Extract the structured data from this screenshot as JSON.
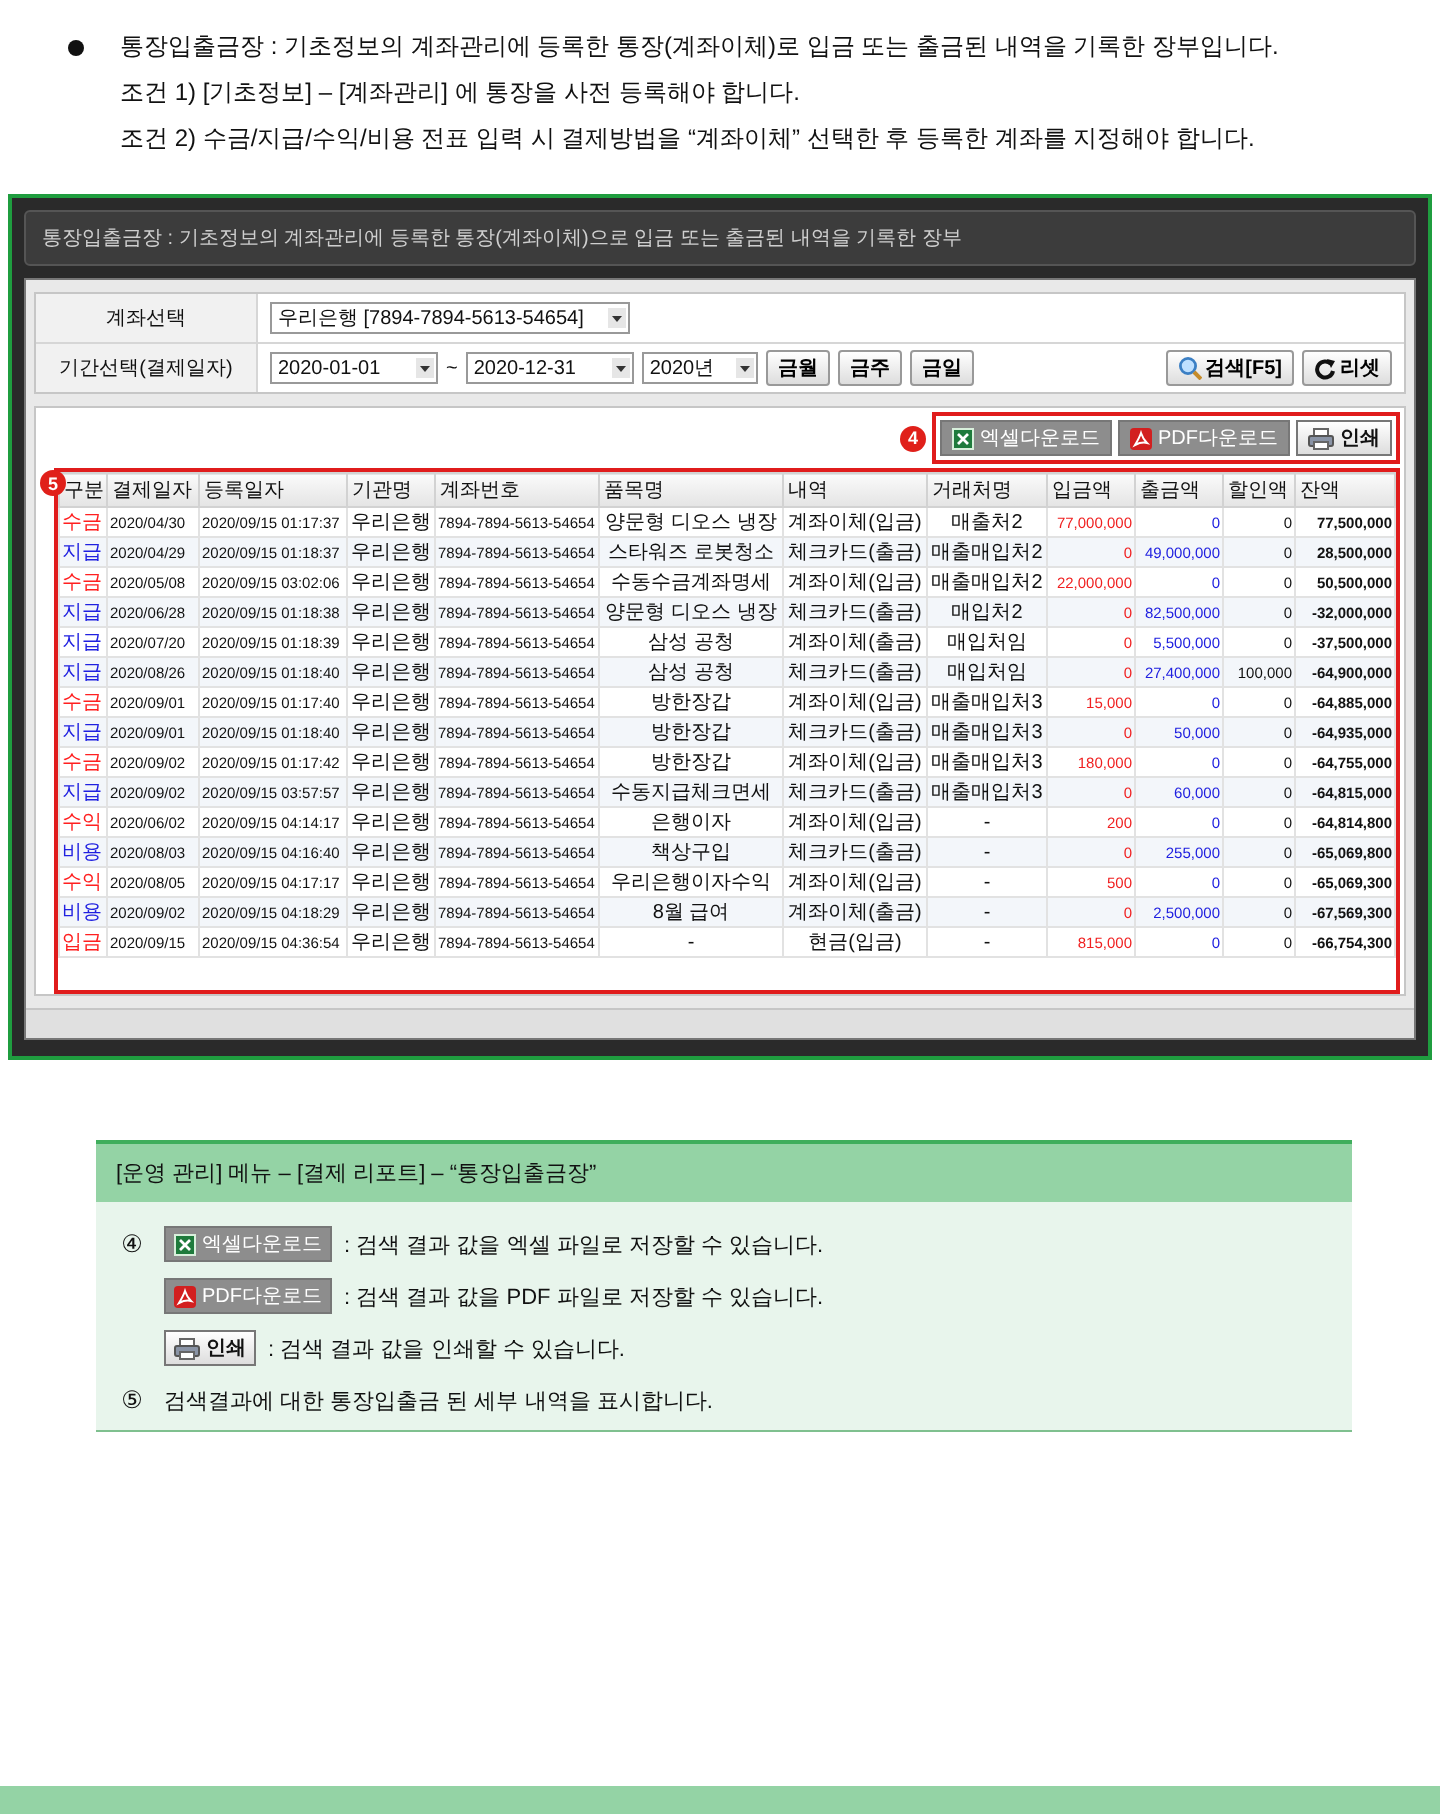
{
  "intro": {
    "lead": "통장입출금장 :  기초정보의 계좌관리에 등록한 통장(계좌이체)로 입금 또는 출금된 내역을 기록한 장부입니다.",
    "conditions": [
      "조건 1) [기초정보] – [계좌관리] 에 통장을 사전 등록해야 합니다.",
      "조건 2) 수금/지급/수익/비용 전표 입력 시 결제방법을 “계좌이체” 선택한 후 등록한 계좌를 지정해야 합니다."
    ]
  },
  "window": {
    "title": "통장입출금장 : 기초정보의 계좌관리에 등록한 통장(계좌이체)으로 입금 또는 출금된 내역을 기록한 장부",
    "filters": {
      "account_label": "계좌선택",
      "account_value": "우리은행 [7894-7894-5613-54654]",
      "period_label": "기간선택(결제일자)",
      "start_date": "2020-01-01",
      "separator": "~",
      "end_date": "2020-12-31",
      "year": "2020년",
      "quick_buttons": [
        "금월",
        "금주",
        "금일"
      ],
      "search_button": "검색[F5]",
      "reset_button": "리셋"
    },
    "toolbar": {
      "callout": "4",
      "buttons": [
        {
          "kind": "excel",
          "label": "엑셀다운로드"
        },
        {
          "kind": "pdf",
          "label": "PDF다운로드"
        },
        {
          "kind": "print",
          "label": "인쇄"
        }
      ]
    },
    "table": {
      "callout": "5",
      "columns": [
        "구분",
        "결제일자",
        "등록일자",
        "기관명",
        "계좌번호",
        "품목명",
        "내역",
        "거래처명",
        "입금액",
        "출금액",
        "할인액",
        "잔액"
      ],
      "rows": [
        {
          "color": "#ff2020",
          "cells": [
            "수금",
            "2020/04/30",
            "2020/09/15 01:17:37",
            "우리은행",
            "7894-7894-5613-54654",
            "양문형 디오스 냉장",
            "계좌이체(입금)",
            "매출처2",
            "77,000,000",
            "0",
            "0",
            "77,500,000"
          ]
        },
        {
          "color": "#2020e0",
          "cells": [
            "지급",
            "2020/04/29",
            "2020/09/15 01:18:37",
            "우리은행",
            "7894-7894-5613-54654",
            "스타워즈 로봇청소",
            "체크카드(출금)",
            "매출매입처2",
            "0",
            "49,000,000",
            "0",
            "28,500,000"
          ]
        },
        {
          "color": "#ff2020",
          "cells": [
            "수금",
            "2020/05/08",
            "2020/09/15 03:02:06",
            "우리은행",
            "7894-7894-5613-54654",
            "수동수금계좌명세",
            "계좌이체(입금)",
            "매출매입처2",
            "22,000,000",
            "0",
            "0",
            "50,500,000"
          ]
        },
        {
          "color": "#2020e0",
          "cells": [
            "지급",
            "2020/06/28",
            "2020/09/15 01:18:38",
            "우리은행",
            "7894-7894-5613-54654",
            "양문형 디오스 냉장",
            "체크카드(출금)",
            "매입처2",
            "0",
            "82,500,000",
            "0",
            "-32,000,000"
          ]
        },
        {
          "color": "#2020e0",
          "cells": [
            "지급",
            "2020/07/20",
            "2020/09/15 01:18:39",
            "우리은행",
            "7894-7894-5613-54654",
            "삼성 공청",
            "계좌이체(출금)",
            "매입처임",
            "0",
            "5,500,000",
            "0",
            "-37,500,000"
          ]
        },
        {
          "color": "#2020e0",
          "cells": [
            "지급",
            "2020/08/26",
            "2020/09/15 01:18:40",
            "우리은행",
            "7894-7894-5613-54654",
            "삼성 공청",
            "체크카드(출금)",
            "매입처임",
            "0",
            "27,400,000",
            "100,000",
            "-64,900,000"
          ]
        },
        {
          "color": "#ff2020",
          "cells": [
            "수금",
            "2020/09/01",
            "2020/09/15 01:17:40",
            "우리은행",
            "7894-7894-5613-54654",
            "방한장갑",
            "계좌이체(입금)",
            "매출매입처3",
            "15,000",
            "0",
            "0",
            "-64,885,000"
          ]
        },
        {
          "color": "#2020e0",
          "cells": [
            "지급",
            "2020/09/01",
            "2020/09/15 01:18:40",
            "우리은행",
            "7894-7894-5613-54654",
            "방한장갑",
            "체크카드(출금)",
            "매출매입처3",
            "0",
            "50,000",
            "0",
            "-64,935,000"
          ]
        },
        {
          "color": "#ff2020",
          "cells": [
            "수금",
            "2020/09/02",
            "2020/09/15 01:17:42",
            "우리은행",
            "7894-7894-5613-54654",
            "방한장갑",
            "계좌이체(입금)",
            "매출매입처3",
            "180,000",
            "0",
            "0",
            "-64,755,000"
          ]
        },
        {
          "color": "#2020e0",
          "cells": [
            "지급",
            "2020/09/02",
            "2020/09/15 03:57:57",
            "우리은행",
            "7894-7894-5613-54654",
            "수동지급체크면세",
            "체크카드(출금)",
            "매출매입처3",
            "0",
            "60,000",
            "0",
            "-64,815,000"
          ]
        },
        {
          "color": "#ff2020",
          "cells": [
            "수익",
            "2020/06/02",
            "2020/09/15 04:14:17",
            "우리은행",
            "7894-7894-5613-54654",
            "은행이자",
            "계좌이체(입금)",
            "-",
            "200",
            "0",
            "0",
            "-64,814,800"
          ]
        },
        {
          "color": "#2020e0",
          "cells": [
            "비용",
            "2020/08/03",
            "2020/09/15 04:16:40",
            "우리은행",
            "7894-7894-5613-54654",
            "책상구입",
            "체크카드(출금)",
            "-",
            "0",
            "255,000",
            "0",
            "-65,069,800"
          ]
        },
        {
          "color": "#ff2020",
          "cells": [
            "수익",
            "2020/08/05",
            "2020/09/15 04:17:17",
            "우리은행",
            "7894-7894-5613-54654",
            "우리은행이자수익",
            "계좌이체(입금)",
            "-",
            "500",
            "0",
            "0",
            "-65,069,300"
          ]
        },
        {
          "color": "#2020e0",
          "cells": [
            "비용",
            "2020/09/02",
            "2020/09/15 04:18:29",
            "우리은행",
            "7894-7894-5613-54654",
            "8월 급여",
            "계좌이체(출금)",
            "-",
            "0",
            "2,500,000",
            "0",
            "-67,569,300"
          ]
        },
        {
          "color": "#ff2020",
          "cells": [
            "입금",
            "2020/09/15",
            "2020/09/15 04:36:54",
            "우리은행",
            "7894-7894-5613-54654",
            "-",
            "현금(입금)",
            "-",
            "815,000",
            "0",
            "0",
            "-66,754,300"
          ]
        }
      ]
    }
  },
  "legend": {
    "heading": "[운영 관리] 메뉴 – [결제 리포트]  – “통장입출금장”",
    "items": [
      {
        "marker": "④",
        "kind": "excel",
        "button": "엑셀다운로드",
        "text": ": 검색 결과 값을 엑셀 파일로 저장할 수 있습니다."
      },
      {
        "kind": "pdf",
        "button": "PDF다운로드",
        "text": ": 검색 결과 값을 PDF 파일로 저장할 수 있습니다."
      },
      {
        "kind": "print",
        "button": "인쇄",
        "text": ": 검색 결과 값을 인쇄할 수 있습니다."
      },
      {
        "marker": "⑤",
        "text": "검색결과에 대한 통장입출금 된 세부 내역을 표시합니다."
      }
    ]
  }
}
